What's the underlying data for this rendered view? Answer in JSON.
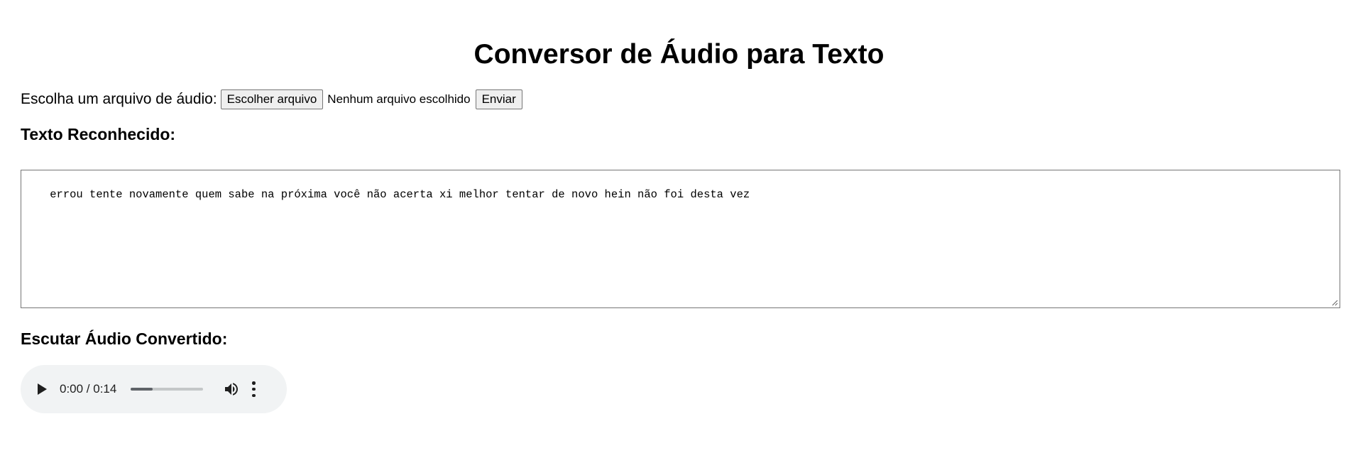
{
  "page": {
    "title": "Conversor de Áudio para Texto"
  },
  "upload": {
    "label": "Escolha um arquivo de áudio:",
    "choose_button_label": "Escolher arquivo",
    "file_status": "Nenhum arquivo escolhido",
    "submit_button_label": "Enviar"
  },
  "recognized": {
    "heading": "Texto Reconhecido:",
    "text": "errou tente novamente quem sabe na próxima você não acerta xi melhor tentar de novo hein não foi desta vez"
  },
  "audio": {
    "heading": "Escutar Áudio Convertido:",
    "time_display": "0:00 / 0:14",
    "progress_fraction": 0.3,
    "icons": {
      "play": "play-icon",
      "volume": "volume-icon",
      "more": "more-vertical-icon"
    }
  }
}
